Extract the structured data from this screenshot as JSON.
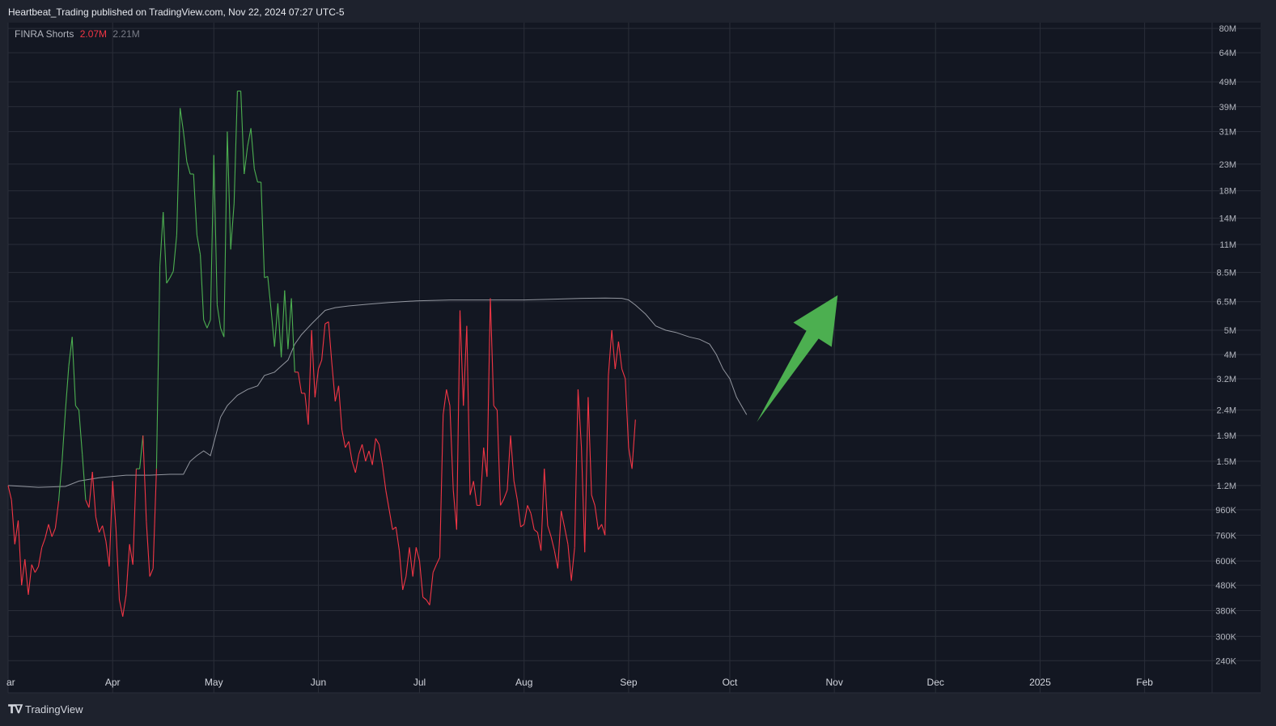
{
  "header": {
    "published": "Heartbeat_Trading published on TradingView.com, Nov 22, 2024 07:27 UTC-5"
  },
  "legend": {
    "name": "FINRA Shorts",
    "value_current": "2.07M",
    "value_avg": "2.21M"
  },
  "footer": {
    "brand": "TradingView",
    "logo_icon": "tradingview-logo-icon"
  },
  "colors": {
    "background": "#131722",
    "panel": "#1e222d",
    "grid": "#2a2e39",
    "up": "#4caf50",
    "down": "#f23645",
    "average": "#b2b5be",
    "arrow": "#4caf50"
  },
  "chart_data": {
    "type": "line",
    "scale": "log",
    "y_ticks": [
      "80M",
      "64M",
      "49M",
      "39M",
      "31M",
      "23M",
      "18M",
      "14M",
      "11M",
      "8.5M",
      "6.5M",
      "5M",
      "4M",
      "3.2M",
      "2.4M",
      "1.9M",
      "1.5M",
      "1.2M",
      "960K",
      "760K",
      "600K",
      "480K",
      "380K",
      "300K",
      "240K"
    ],
    "y_tick_values": [
      80000000,
      64000000,
      49000000,
      39000000,
      31000000,
      23000000,
      18000000,
      14000000,
      11000000,
      8500000,
      6500000,
      5000000,
      4000000,
      3200000,
      2400000,
      1900000,
      1500000,
      1200000,
      960000,
      760000,
      600000,
      480000,
      380000,
      300000,
      240000
    ],
    "x_ticks": [
      {
        "label": "ar",
        "date": "2024-03-01"
      },
      {
        "label": "Apr",
        "date": "2024-04-01"
      },
      {
        "label": "May",
        "date": "2024-05-01"
      },
      {
        "label": "Jun",
        "date": "2024-06-01"
      },
      {
        "label": "Jul",
        "date": "2024-07-01"
      },
      {
        "label": "Aug",
        "date": "2024-08-01"
      },
      {
        "label": "Sep",
        "date": "2024-09-01"
      },
      {
        "label": "Oct",
        "date": "2024-10-01"
      },
      {
        "label": "Nov",
        "date": "2024-11-01"
      },
      {
        "label": "Dec",
        "date": "2024-12-01"
      },
      {
        "label": "2025",
        "date": "2025-01-01"
      },
      {
        "label": "Feb",
        "date": "2025-02-01"
      }
    ],
    "x_range": [
      "2024-03-01",
      "2025-02-21"
    ],
    "y_range": [
      220000,
      85000000
    ],
    "grid": true,
    "series": [
      {
        "name": "FINRA Shorts",
        "color_up": "#4caf50",
        "color_down": "#f23645",
        "points": [
          [
            "2024-03-01",
            1200000
          ],
          [
            "2024-03-02",
            1050000
          ],
          [
            "2024-03-03",
            700000
          ],
          [
            "2024-03-04",
            870000
          ],
          [
            "2024-03-05",
            480000
          ],
          [
            "2024-03-06",
            610000
          ],
          [
            "2024-03-07",
            440000
          ],
          [
            "2024-03-08",
            580000
          ],
          [
            "2024-03-09",
            540000
          ],
          [
            "2024-03-10",
            570000
          ],
          [
            "2024-03-11",
            680000
          ],
          [
            "2024-03-12",
            740000
          ],
          [
            "2024-03-13",
            840000
          ],
          [
            "2024-03-14",
            750000
          ],
          [
            "2024-03-15",
            810000
          ],
          [
            "2024-03-16",
            1040000
          ],
          [
            "2024-03-17",
            1500000
          ],
          [
            "2024-03-18",
            2400000
          ],
          [
            "2024-03-19",
            3600000
          ],
          [
            "2024-03-20",
            4700000
          ],
          [
            "2024-03-21",
            2500000
          ],
          [
            "2024-03-22",
            2400000
          ],
          [
            "2024-03-23",
            1600000
          ],
          [
            "2024-03-24",
            1050000
          ],
          [
            "2024-03-25",
            980000
          ],
          [
            "2024-03-26",
            1360000
          ],
          [
            "2024-03-27",
            900000
          ],
          [
            "2024-03-28",
            780000
          ],
          [
            "2024-03-29",
            830000
          ],
          [
            "2024-03-30",
            720000
          ],
          [
            "2024-03-31",
            570000
          ],
          [
            "2024-04-01",
            1250000
          ],
          [
            "2024-04-02",
            800000
          ],
          [
            "2024-04-03",
            420000
          ],
          [
            "2024-04-04",
            360000
          ],
          [
            "2024-04-05",
            440000
          ],
          [
            "2024-04-06",
            700000
          ],
          [
            "2024-04-07",
            580000
          ],
          [
            "2024-04-08",
            1400000
          ],
          [
            "2024-04-09",
            1400000
          ],
          [
            "2024-04-10",
            1900000
          ],
          [
            "2024-04-11",
            860000
          ],
          [
            "2024-04-12",
            520000
          ],
          [
            "2024-04-13",
            560000
          ],
          [
            "2024-04-14",
            1400000
          ],
          [
            "2024-04-15",
            9000000
          ],
          [
            "2024-04-16",
            14800000
          ],
          [
            "2024-04-17",
            7700000
          ],
          [
            "2024-04-18",
            8100000
          ],
          [
            "2024-04-19",
            8600000
          ],
          [
            "2024-04-20",
            12000000
          ],
          [
            "2024-04-21",
            38500000
          ],
          [
            "2024-04-22",
            31000000
          ],
          [
            "2024-04-23",
            23500000
          ],
          [
            "2024-04-24",
            21000000
          ],
          [
            "2024-04-25",
            21000000
          ],
          [
            "2024-04-26",
            12000000
          ],
          [
            "2024-04-27",
            10000000
          ],
          [
            "2024-04-28",
            5500000
          ],
          [
            "2024-04-29",
            5100000
          ],
          [
            "2024-04-30",
            5500000
          ],
          [
            "2024-05-01",
            25000000
          ],
          [
            "2024-05-02",
            6300000
          ],
          [
            "2024-05-03",
            5100000
          ],
          [
            "2024-05-04",
            4700000
          ],
          [
            "2024-05-05",
            31000000
          ],
          [
            "2024-05-06",
            10500000
          ],
          [
            "2024-05-07",
            16000000
          ],
          [
            "2024-05-08",
            45000000
          ],
          [
            "2024-05-09",
            45000000
          ],
          [
            "2024-05-10",
            21000000
          ],
          [
            "2024-05-11",
            27000000
          ],
          [
            "2024-05-12",
            32000000
          ],
          [
            "2024-05-13",
            22000000
          ],
          [
            "2024-05-14",
            19500000
          ],
          [
            "2024-05-15",
            19500000
          ],
          [
            "2024-05-16",
            8100000
          ],
          [
            "2024-05-17",
            8200000
          ],
          [
            "2024-05-18",
            6000000
          ],
          [
            "2024-05-19",
            4300000
          ],
          [
            "2024-05-20",
            6400000
          ],
          [
            "2024-05-21",
            3900000
          ],
          [
            "2024-05-22",
            7200000
          ],
          [
            "2024-05-23",
            4200000
          ],
          [
            "2024-05-24",
            6700000
          ],
          [
            "2024-05-25",
            3400000
          ],
          [
            "2024-05-26",
            3400000
          ],
          [
            "2024-05-27",
            2800000
          ],
          [
            "2024-05-28",
            2800000
          ],
          [
            "2024-05-29",
            2100000
          ],
          [
            "2024-05-30",
            5000000
          ],
          [
            "2024-05-31",
            2700000
          ],
          [
            "2024-06-01",
            3500000
          ],
          [
            "2024-06-02",
            3800000
          ],
          [
            "2024-06-03",
            5300000
          ],
          [
            "2024-06-04",
            5400000
          ],
          [
            "2024-06-05",
            3700000
          ],
          [
            "2024-06-06",
            2600000
          ],
          [
            "2024-06-07",
            3000000
          ],
          [
            "2024-06-08",
            2000000
          ],
          [
            "2024-06-09",
            1700000
          ],
          [
            "2024-06-10",
            1800000
          ],
          [
            "2024-06-11",
            1500000
          ],
          [
            "2024-06-12",
            1350000
          ],
          [
            "2024-06-13",
            1600000
          ],
          [
            "2024-06-14",
            1750000
          ],
          [
            "2024-06-15",
            1500000
          ],
          [
            "2024-06-16",
            1650000
          ],
          [
            "2024-06-17",
            1450000
          ],
          [
            "2024-06-18",
            1850000
          ],
          [
            "2024-06-19",
            1750000
          ],
          [
            "2024-06-20",
            1450000
          ],
          [
            "2024-06-21",
            1150000
          ],
          [
            "2024-06-22",
            960000
          ],
          [
            "2024-06-23",
            800000
          ],
          [
            "2024-06-24",
            820000
          ],
          [
            "2024-06-25",
            660000
          ],
          [
            "2024-06-26",
            460000
          ],
          [
            "2024-06-27",
            520000
          ],
          [
            "2024-06-28",
            680000
          ],
          [
            "2024-06-29",
            520000
          ],
          [
            "2024-06-30",
            680000
          ],
          [
            "2024-07-01",
            600000
          ],
          [
            "2024-07-02",
            430000
          ],
          [
            "2024-07-03",
            420000
          ],
          [
            "2024-07-04",
            400000
          ],
          [
            "2024-07-05",
            540000
          ],
          [
            "2024-07-06",
            580000
          ],
          [
            "2024-07-07",
            620000
          ],
          [
            "2024-07-08",
            2300000
          ],
          [
            "2024-07-09",
            2900000
          ],
          [
            "2024-07-10",
            2500000
          ],
          [
            "2024-07-11",
            1150000
          ],
          [
            "2024-07-12",
            800000
          ],
          [
            "2024-07-13",
            6000000
          ],
          [
            "2024-07-14",
            2500000
          ],
          [
            "2024-07-15",
            5200000
          ],
          [
            "2024-07-16",
            1100000
          ],
          [
            "2024-07-17",
            1250000
          ],
          [
            "2024-07-18",
            1000000
          ],
          [
            "2024-07-19",
            1000000
          ],
          [
            "2024-07-20",
            1700000
          ],
          [
            "2024-07-21",
            1300000
          ],
          [
            "2024-07-22",
            6700000
          ],
          [
            "2024-07-23",
            2500000
          ],
          [
            "2024-07-24",
            2400000
          ],
          [
            "2024-07-25",
            1000000
          ],
          [
            "2024-07-26",
            1060000
          ],
          [
            "2024-07-27",
            1150000
          ],
          [
            "2024-07-28",
            1900000
          ],
          [
            "2024-07-29",
            1250000
          ],
          [
            "2024-07-30",
            1050000
          ],
          [
            "2024-07-31",
            820000
          ],
          [
            "2024-08-01",
            840000
          ],
          [
            "2024-08-02",
            1000000
          ],
          [
            "2024-08-03",
            930000
          ],
          [
            "2024-08-04",
            800000
          ],
          [
            "2024-08-05",
            780000
          ],
          [
            "2024-08-06",
            660000
          ],
          [
            "2024-08-07",
            1400000
          ],
          [
            "2024-08-08",
            830000
          ],
          [
            "2024-08-09",
            750000
          ],
          [
            "2024-08-10",
            660000
          ],
          [
            "2024-08-11",
            560000
          ],
          [
            "2024-08-12",
            950000
          ],
          [
            "2024-08-13",
            820000
          ],
          [
            "2024-08-14",
            700000
          ],
          [
            "2024-08-15",
            500000
          ],
          [
            "2024-08-16",
            680000
          ],
          [
            "2024-08-17",
            2900000
          ],
          [
            "2024-08-18",
            1700000
          ],
          [
            "2024-08-19",
            650000
          ],
          [
            "2024-08-20",
            2700000
          ],
          [
            "2024-08-21",
            1100000
          ],
          [
            "2024-08-22",
            1000000
          ],
          [
            "2024-08-23",
            800000
          ],
          [
            "2024-08-24",
            840000
          ],
          [
            "2024-08-25",
            760000
          ],
          [
            "2024-08-26",
            3300000
          ],
          [
            "2024-08-27",
            5000000
          ],
          [
            "2024-08-28",
            3500000
          ],
          [
            "2024-08-29",
            4500000
          ],
          [
            "2024-08-30",
            3500000
          ],
          [
            "2024-08-31",
            3200000
          ],
          [
            "2024-09-01",
            1700000
          ],
          [
            "2024-09-02",
            1400000
          ],
          [
            "2024-09-03",
            2200000
          ]
        ]
      },
      {
        "name": "FINRA Shorts average",
        "color": "#b2b5be",
        "points": [
          [
            "2024-03-01",
            1200000
          ],
          [
            "2024-03-10",
            1180000
          ],
          [
            "2024-03-18",
            1190000
          ],
          [
            "2024-03-22",
            1250000
          ],
          [
            "2024-03-28",
            1290000
          ],
          [
            "2024-04-05",
            1320000
          ],
          [
            "2024-04-12",
            1320000
          ],
          [
            "2024-04-18",
            1330000
          ],
          [
            "2024-04-22",
            1330000
          ],
          [
            "2024-04-24",
            1500000
          ],
          [
            "2024-04-26",
            1580000
          ],
          [
            "2024-04-28",
            1650000
          ],
          [
            "2024-04-30",
            1580000
          ],
          [
            "2024-05-01",
            1780000
          ],
          [
            "2024-05-03",
            2250000
          ],
          [
            "2024-05-05",
            2500000
          ],
          [
            "2024-05-08",
            2750000
          ],
          [
            "2024-05-11",
            2900000
          ],
          [
            "2024-05-14",
            3000000
          ],
          [
            "2024-05-16",
            3300000
          ],
          [
            "2024-05-19",
            3400000
          ],
          [
            "2024-05-21",
            3600000
          ],
          [
            "2024-05-23",
            3800000
          ],
          [
            "2024-05-25",
            4400000
          ],
          [
            "2024-05-27",
            4800000
          ],
          [
            "2024-05-30",
            5300000
          ],
          [
            "2024-06-03",
            6000000
          ],
          [
            "2024-06-06",
            6150000
          ],
          [
            "2024-06-10",
            6250000
          ],
          [
            "2024-06-16",
            6350000
          ],
          [
            "2024-06-22",
            6450000
          ],
          [
            "2024-06-30",
            6550000
          ],
          [
            "2024-07-10",
            6600000
          ],
          [
            "2024-07-20",
            6600000
          ],
          [
            "2024-08-01",
            6600000
          ],
          [
            "2024-08-10",
            6650000
          ],
          [
            "2024-08-18",
            6700000
          ],
          [
            "2024-08-25",
            6720000
          ],
          [
            "2024-08-30",
            6700000
          ],
          [
            "2024-09-01",
            6600000
          ],
          [
            "2024-09-03",
            6300000
          ],
          [
            "2024-09-06",
            5800000
          ],
          [
            "2024-09-09",
            5200000
          ],
          [
            "2024-09-12",
            5000000
          ],
          [
            "2024-09-15",
            4900000
          ],
          [
            "2024-09-19",
            4700000
          ],
          [
            "2024-09-22",
            4600000
          ],
          [
            "2024-09-25",
            4400000
          ],
          [
            "2024-09-27",
            4000000
          ],
          [
            "2024-09-29",
            3500000
          ],
          [
            "2024-10-01",
            3200000
          ],
          [
            "2024-10-03",
            2700000
          ],
          [
            "2024-10-06",
            2300000
          ]
        ]
      }
    ],
    "annotations": [
      {
        "type": "arrow",
        "color": "#4caf50",
        "from": [
          "2024-10-09",
          2150000
        ],
        "to": [
          "2024-11-02",
          6900000
        ]
      }
    ]
  }
}
